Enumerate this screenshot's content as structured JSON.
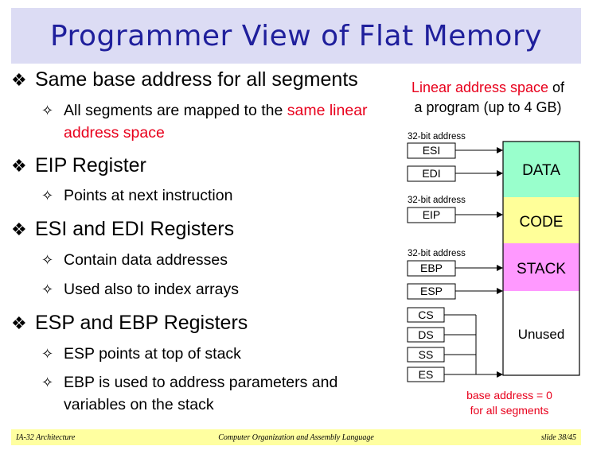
{
  "title": "Programmer View of Flat Memory",
  "bullets": [
    {
      "text": "Same base address for all segments",
      "subs": [
        {
          "parts": [
            {
              "t": "All segments are mapped to the ",
              "red": false
            },
            {
              "t": "same linear address space",
              "red": true
            }
          ]
        }
      ]
    },
    {
      "text": "EIP Register",
      "subs": [
        {
          "parts": [
            {
              "t": "Points at next instruction",
              "red": false
            }
          ]
        }
      ]
    },
    {
      "text": "ESI and EDI Registers",
      "subs": [
        {
          "parts": [
            {
              "t": "Contain data addresses",
              "red": false
            }
          ]
        },
        {
          "parts": [
            {
              "t": "Used also to index arrays",
              "red": false
            }
          ]
        }
      ]
    },
    {
      "text": "ESP and EBP Registers",
      "subs": [
        {
          "parts": [
            {
              "t": "ESP points at top of stack",
              "red": false
            }
          ]
        },
        {
          "parts": [
            {
              "t": "EBP is used to address parameters and variables on the stack",
              "red": false
            }
          ]
        }
      ]
    }
  ],
  "diagram": {
    "heading_red": "Linear address space",
    "heading_rest": " of",
    "heading_line2": "a program (up to 4 GB)",
    "address_label": "32-bit address",
    "registers": {
      "esi": "ESI",
      "edi": "EDI",
      "eip": "EIP",
      "ebp": "EBP",
      "esp": "ESP",
      "cs": "CS",
      "ds": "DS",
      "ss": "SS",
      "es": "ES"
    },
    "regions": [
      {
        "label": "DATA",
        "color": "#99ffcc"
      },
      {
        "label": "CODE",
        "color": "#ffff99"
      },
      {
        "label": "STACK",
        "color": "#ff99ff"
      },
      {
        "label": "Unused",
        "color": "#ffffff"
      }
    ],
    "note_line1": "base address = 0",
    "note_line2": "for all segments"
  },
  "footer": {
    "left": "IA-32 Architecture",
    "center": "Computer Organization and Assembly Language",
    "right": "slide 38/45"
  }
}
